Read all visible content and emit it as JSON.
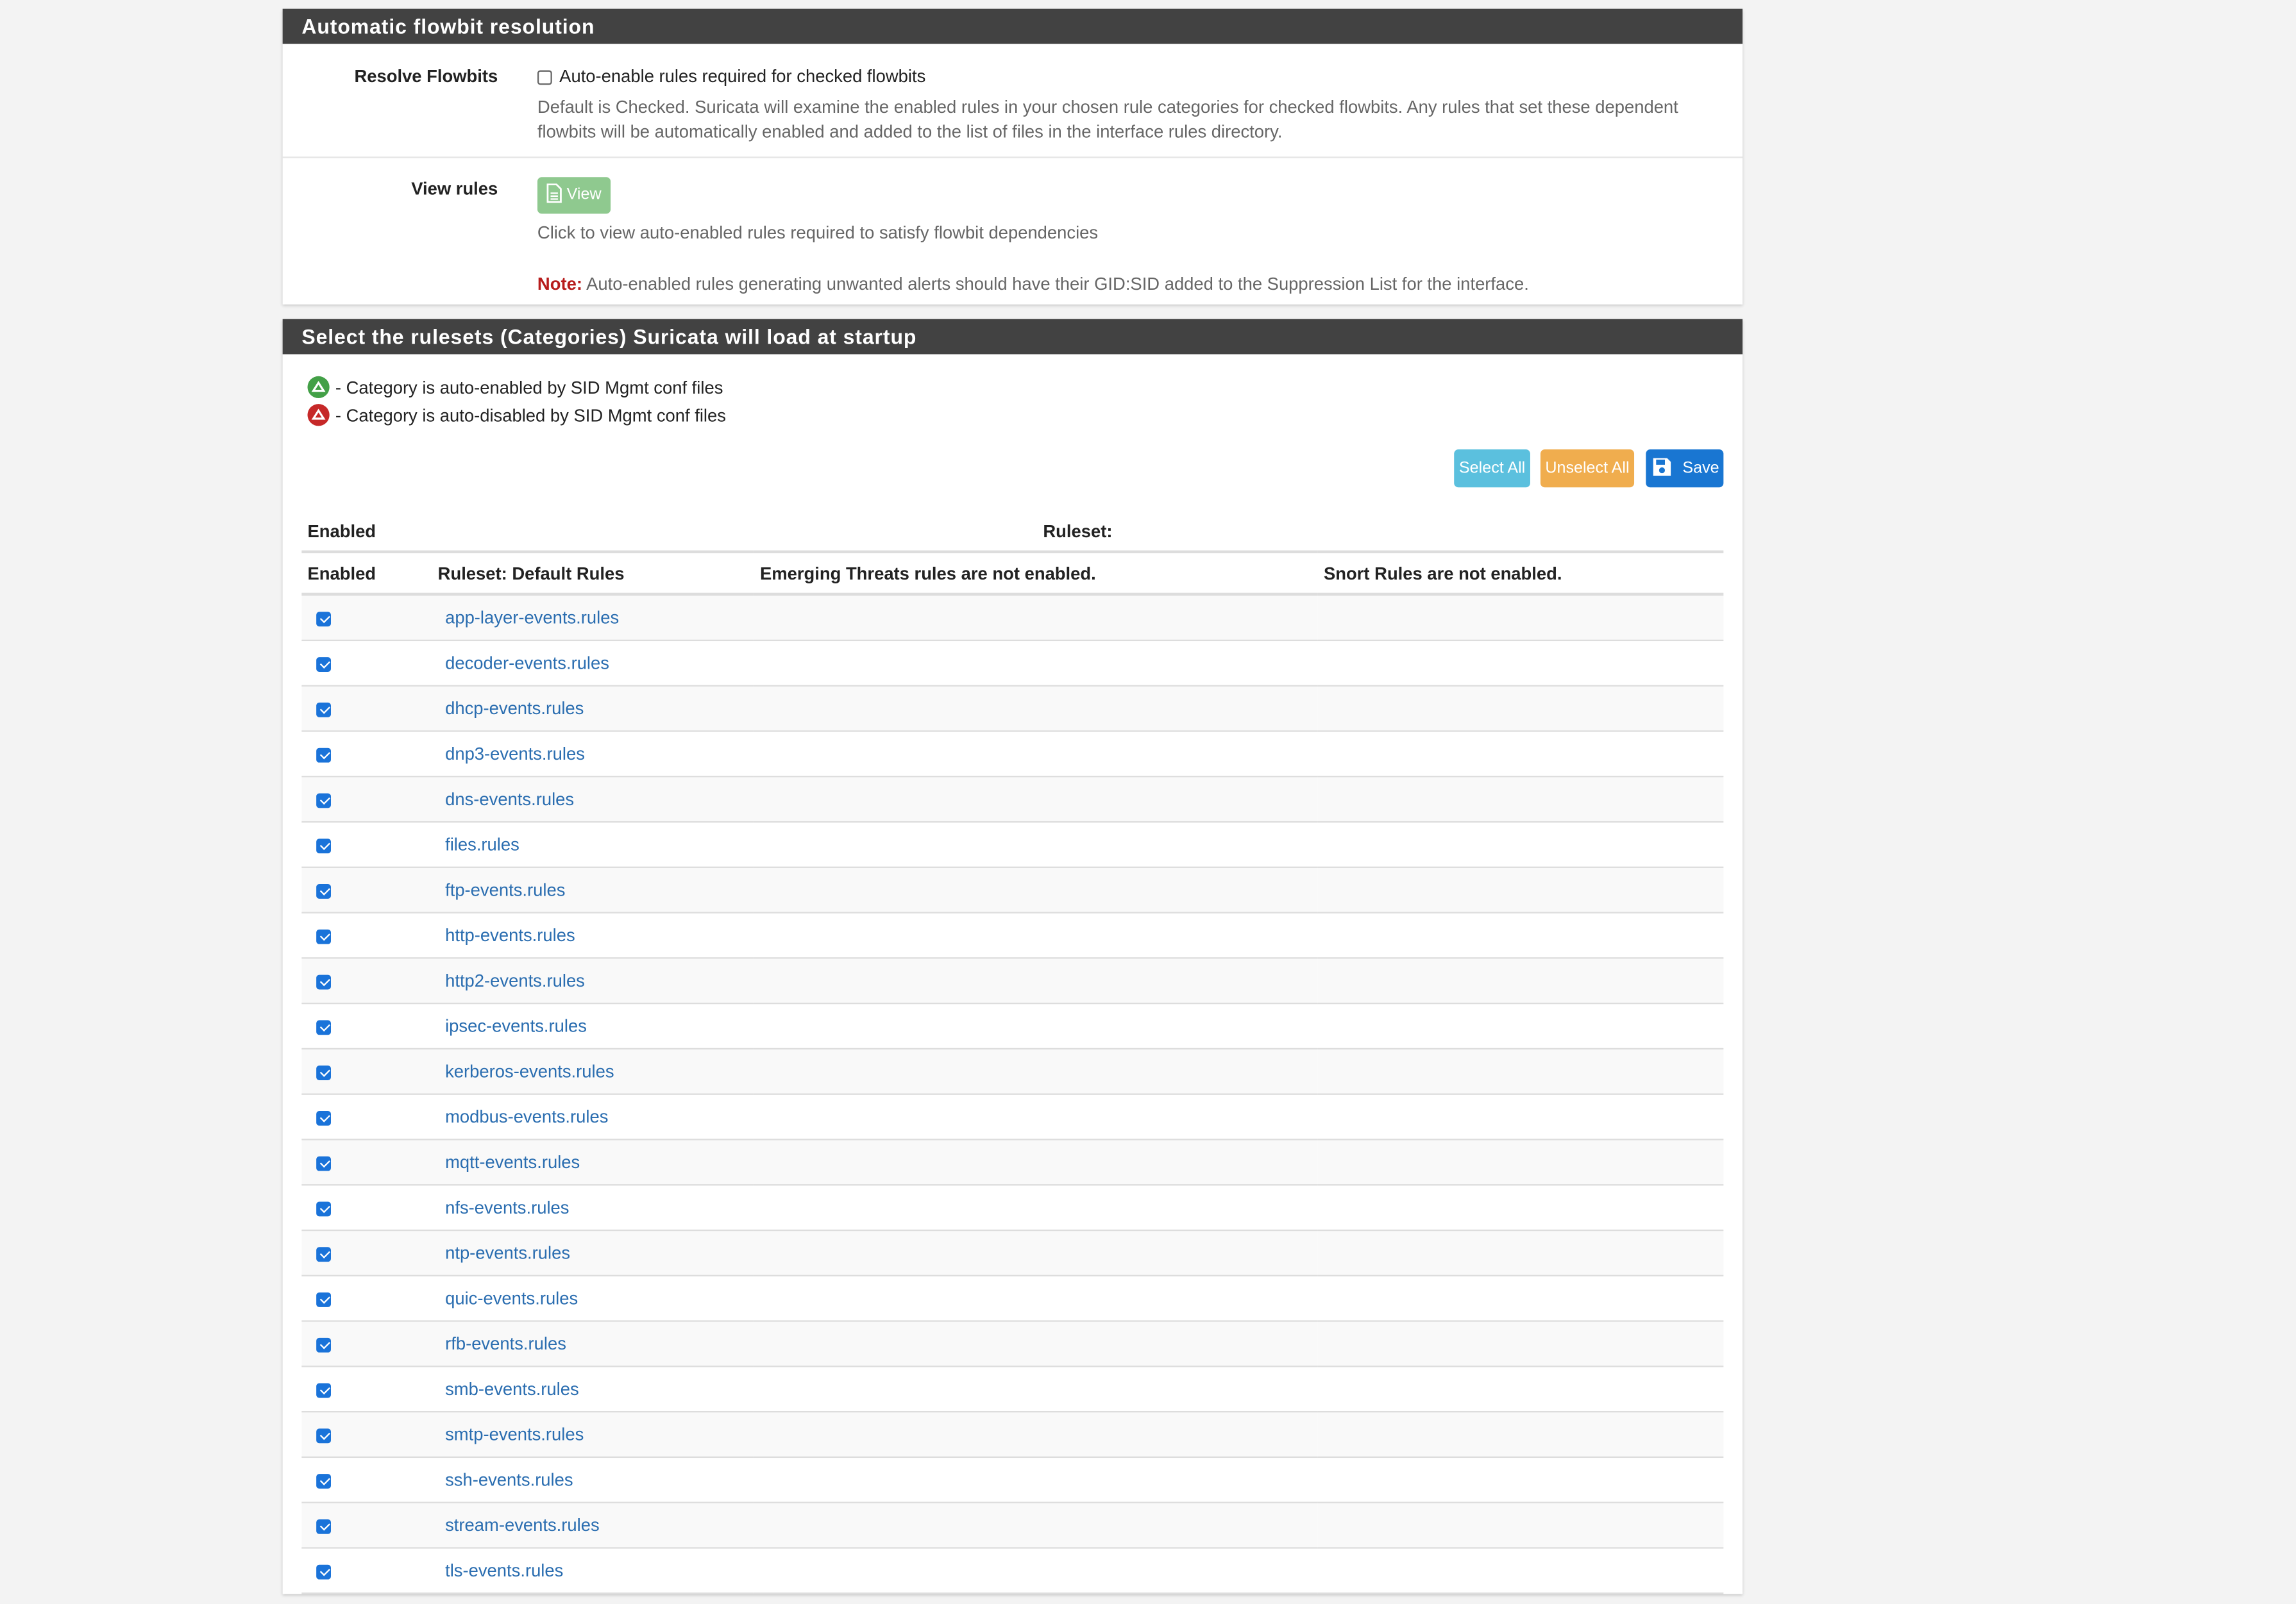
{
  "flowbit_panel": {
    "title": "Automatic flowbit resolution",
    "resolve_label": "Resolve Flowbits",
    "resolve_checkbox_label": "Auto-enable rules required for checked flowbits",
    "resolve_checked": false,
    "resolve_help": "Default is Checked. Suricata will examine the enabled rules in your chosen rule categories for checked flowbits. Any rules that set these dependent flowbits will be automatically enabled and added to the list of files in the interface rules directory.",
    "view_label": "View rules",
    "view_button_label": "View",
    "view_help": "Click to view auto-enabled rules required to satisfy flowbit dependencies",
    "note_prefix": "Note:",
    "note_text": "Auto-enabled rules generating unwanted alerts should have their GID:SID added to the Suppression List for the interface."
  },
  "ruleset_panel": {
    "title": "Select the rulesets (Categories) Suricata will load at startup",
    "legend_enabled": "- Category is auto-enabled by SID Mgmt conf files",
    "legend_disabled": "- Category is auto-disabled by SID Mgmt conf files",
    "select_all_label": "Select All",
    "unselect_all_label": "Unselect All",
    "save_label": "Save",
    "colors": {
      "select_all": "#5bc0de",
      "unselect_all": "#f0ad4e",
      "save": "#1976d2",
      "auto_enabled": "#43a047",
      "auto_disabled": "#c62828",
      "link": "#2a6db0",
      "header_bar": "#424242"
    },
    "table": {
      "header_row_1": {
        "enabled": "Enabled",
        "ruleset": "Ruleset:"
      },
      "header_row_2": {
        "enabled": "Enabled",
        "default_rules": "Ruleset: Default Rules",
        "emerging_threats": "Emerging Threats rules are not enabled.",
        "snort": "Snort Rules are not enabled."
      },
      "rows": [
        {
          "checked": true,
          "name": "app-layer-events.rules"
        },
        {
          "checked": true,
          "name": "decoder-events.rules"
        },
        {
          "checked": true,
          "name": "dhcp-events.rules"
        },
        {
          "checked": true,
          "name": "dnp3-events.rules"
        },
        {
          "checked": true,
          "name": "dns-events.rules"
        },
        {
          "checked": true,
          "name": "files.rules"
        },
        {
          "checked": true,
          "name": "ftp-events.rules"
        },
        {
          "checked": true,
          "name": "http-events.rules"
        },
        {
          "checked": true,
          "name": "http2-events.rules"
        },
        {
          "checked": true,
          "name": "ipsec-events.rules"
        },
        {
          "checked": true,
          "name": "kerberos-events.rules"
        },
        {
          "checked": true,
          "name": "modbus-events.rules"
        },
        {
          "checked": true,
          "name": "mqtt-events.rules"
        },
        {
          "checked": true,
          "name": "nfs-events.rules"
        },
        {
          "checked": true,
          "name": "ntp-events.rules"
        },
        {
          "checked": true,
          "name": "quic-events.rules"
        },
        {
          "checked": true,
          "name": "rfb-events.rules"
        },
        {
          "checked": true,
          "name": "smb-events.rules"
        },
        {
          "checked": true,
          "name": "smtp-events.rules"
        },
        {
          "checked": true,
          "name": "ssh-events.rules"
        },
        {
          "checked": true,
          "name": "stream-events.rules"
        },
        {
          "checked": true,
          "name": "tls-events.rules"
        }
      ]
    }
  }
}
